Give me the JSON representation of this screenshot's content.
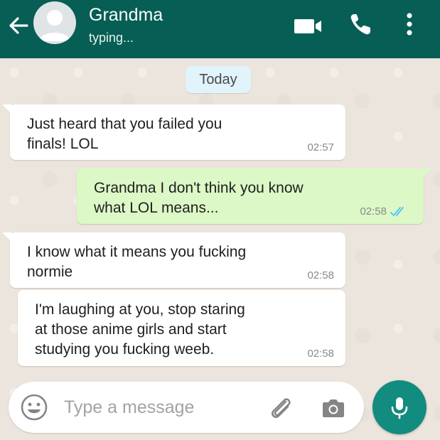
{
  "header": {
    "contact_name": "Grandma",
    "status": "typing...",
    "icons": [
      "back-arrow-icon",
      "avatar-placeholder-icon",
      "video-call-icon",
      "phone-call-icon",
      "more-options-icon"
    ]
  },
  "chat": {
    "date_label": "Today",
    "messages": [
      {
        "direction": "incoming",
        "text": "Just heard that you failed you\nfinals! LOL",
        "time": "02:57"
      },
      {
        "direction": "outgoing",
        "text": "Grandma I don't think you know\nwhat LOL means...",
        "time": "02:58",
        "status": "read"
      },
      {
        "direction": "incoming",
        "text": "I know what it means you fucking\nnormie",
        "time": "02:58"
      },
      {
        "direction": "incoming",
        "text": "I'm laughing at you, stop staring\nat those anime girls and start\nstudying you fucking weeb.",
        "time": "02:58"
      }
    ]
  },
  "composer": {
    "placeholder": "Type a message",
    "value": "",
    "icons": [
      "emoji-icon",
      "attach-icon",
      "camera-icon",
      "mic-icon"
    ]
  },
  "colors": {
    "header": "#075e54",
    "incoming_bubble": "#ffffff",
    "outgoing_bubble": "#dcf8c6",
    "date_chip": "#e1f3fb",
    "mic_button": "#128c7e",
    "read_ticks": "#4fc3f7",
    "wallpaper": "#ece5dd"
  }
}
